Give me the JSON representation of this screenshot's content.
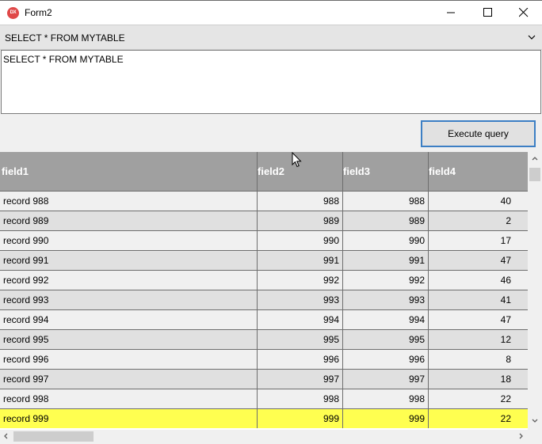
{
  "window": {
    "title": "Form2",
    "icon_label": "DX",
    "controls": [
      "minimize-icon",
      "maximize-icon",
      "close-icon"
    ]
  },
  "query_combo": {
    "selected": "SELECT * FROM MYTABLE",
    "icon": "chevron-down-icon"
  },
  "query_editor": {
    "value": "SELECT * FROM MYTABLE"
  },
  "execute_button": {
    "label": "Execute query"
  },
  "grid": {
    "columns": [
      "field1",
      "field2",
      "field3",
      "field4"
    ],
    "rows": [
      [
        "record 988",
        "988",
        "988",
        "40"
      ],
      [
        "record 989",
        "989",
        "989",
        "2"
      ],
      [
        "record 990",
        "990",
        "990",
        "17"
      ],
      [
        "record 991",
        "991",
        "991",
        "47"
      ],
      [
        "record 992",
        "992",
        "992",
        "46"
      ],
      [
        "record 993",
        "993",
        "993",
        "41"
      ],
      [
        "record 994",
        "994",
        "994",
        "47"
      ],
      [
        "record 995",
        "995",
        "995",
        "12"
      ],
      [
        "record 996",
        "996",
        "996",
        "8"
      ],
      [
        "record 997",
        "997",
        "997",
        "18"
      ],
      [
        "record 998",
        "998",
        "998",
        "22"
      ],
      [
        "record 999",
        "999",
        "999",
        "22"
      ]
    ],
    "selected_row_index": 11
  },
  "colors": {
    "header_bg": "#a0a0a0",
    "header_text": "#ffffff",
    "row_odd": "#f0f0f0",
    "row_even": "#e0e0e0",
    "selected_row": "#ffff50",
    "button_border": "#3c7fc4",
    "app_icon": "#e04848"
  }
}
